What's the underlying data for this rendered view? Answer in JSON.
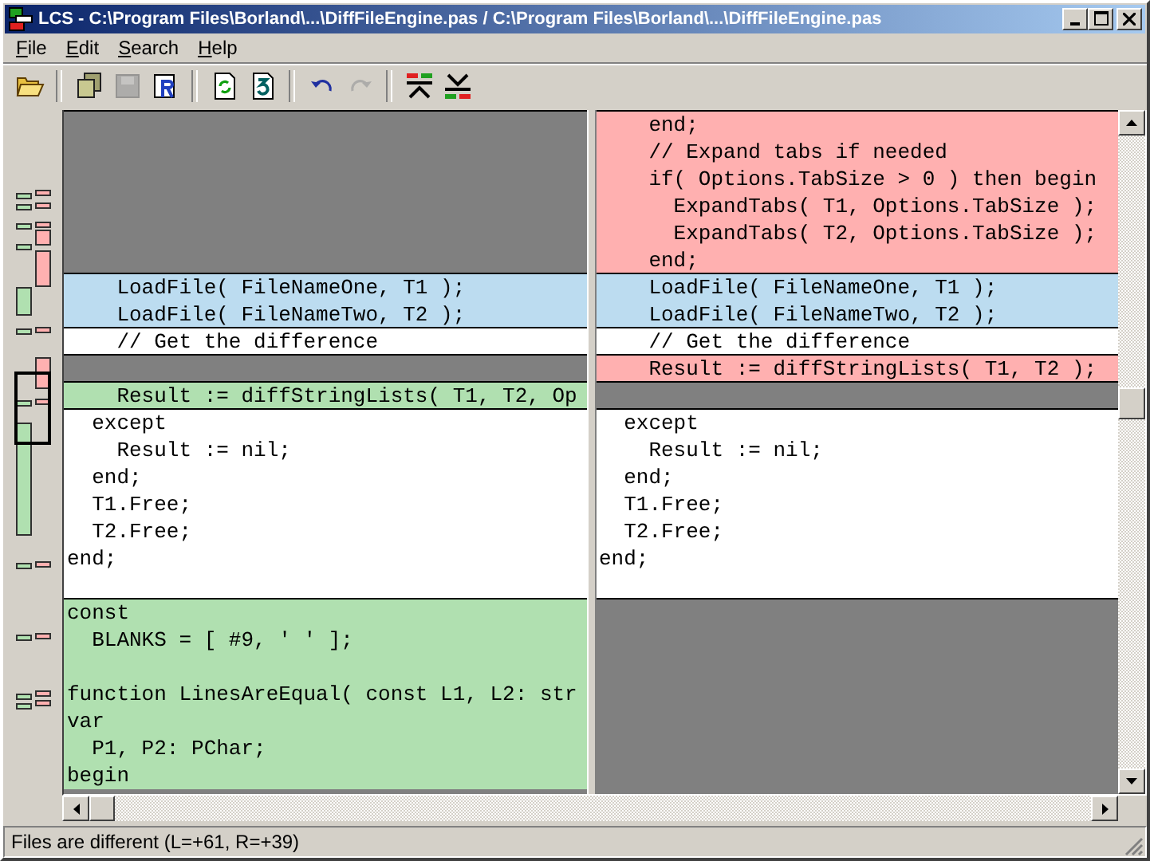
{
  "window": {
    "title": "LCS - C:\\Program Files\\Borland\\...\\DiffFileEngine.pas / C:\\Program Files\\Borland\\...\\DiffFileEngine.pas"
  },
  "menu": [
    "File",
    "Edit",
    "Search",
    "Help"
  ],
  "toolbar": [
    {
      "kind": "open",
      "disabled": false
    },
    {
      "kind": "separator"
    },
    {
      "kind": "copy",
      "disabled": false
    },
    {
      "kind": "save",
      "disabled": true
    },
    {
      "kind": "reload",
      "disabled": false
    },
    {
      "kind": "separator"
    },
    {
      "kind": "refresh",
      "disabled": false
    },
    {
      "kind": "page3",
      "disabled": false
    },
    {
      "kind": "separator"
    },
    {
      "kind": "undo",
      "disabled": false
    },
    {
      "kind": "redo",
      "disabled": true
    },
    {
      "kind": "separator"
    },
    {
      "kind": "prev-diff",
      "disabled": false
    },
    {
      "kind": "next-diff",
      "disabled": false
    }
  ],
  "left_pane": {
    "lines": [
      {
        "kind": "missing"
      },
      {
        "kind": "missing"
      },
      {
        "kind": "missing"
      },
      {
        "kind": "missing"
      },
      {
        "kind": "missing"
      },
      {
        "kind": "missing"
      },
      {
        "kind": "moved",
        "text": "    LoadFile( FileNameOne, T1 );"
      },
      {
        "kind": "moved",
        "text": "    LoadFile( FileNameTwo, T2 );"
      },
      {
        "kind": "same",
        "text": "    // Get the difference"
      },
      {
        "kind": "missing"
      },
      {
        "kind": "added",
        "text": "    Result := diffStringLists( T1, T2, Op"
      },
      {
        "kind": "same",
        "text": "  except"
      },
      {
        "kind": "same",
        "text": "    Result := nil;"
      },
      {
        "kind": "same",
        "text": "  end;"
      },
      {
        "kind": "same",
        "text": "  T1.Free;"
      },
      {
        "kind": "same",
        "text": "  T2.Free;"
      },
      {
        "kind": "same",
        "text": "end;"
      },
      {
        "kind": "same"
      },
      {
        "kind": "added",
        "text": "const"
      },
      {
        "kind": "added",
        "text": "  BLANKS = [ #9, ' ' ];"
      },
      {
        "kind": "added"
      },
      {
        "kind": "added",
        "text": "function LinesAreEqual( const L1, L2: str"
      },
      {
        "kind": "added",
        "text": "var"
      },
      {
        "kind": "added",
        "text": "  P1, P2: PChar;"
      },
      {
        "kind": "added",
        "text": "begin"
      }
    ]
  },
  "right_pane": {
    "lines": [
      {
        "kind": "deleted",
        "text": "    end;"
      },
      {
        "kind": "deleted",
        "text": "    // Expand tabs if needed"
      },
      {
        "kind": "deleted",
        "text": "    if( Options.TabSize > 0 ) then begin"
      },
      {
        "kind": "deleted",
        "text": "      ExpandTabs( T1, Options.TabSize );"
      },
      {
        "kind": "deleted",
        "text": "      ExpandTabs( T2, Options.TabSize );"
      },
      {
        "kind": "deleted",
        "text": "    end;"
      },
      {
        "kind": "moved",
        "text": "    LoadFile( FileNameOne, T1 );"
      },
      {
        "kind": "moved",
        "text": "    LoadFile( FileNameTwo, T2 );"
      },
      {
        "kind": "same",
        "text": "    // Get the difference"
      },
      {
        "kind": "deleted",
        "text": "    Result := diffStringLists( T1, T2 );"
      },
      {
        "kind": "missing"
      },
      {
        "kind": "same",
        "text": "  except"
      },
      {
        "kind": "same",
        "text": "    Result := nil;"
      },
      {
        "kind": "same",
        "text": "  end;"
      },
      {
        "kind": "same",
        "text": "  T1.Free;"
      },
      {
        "kind": "same",
        "text": "  T2.Free;"
      },
      {
        "kind": "same",
        "text": "end;"
      },
      {
        "kind": "same"
      },
      {
        "kind": "missing"
      },
      {
        "kind": "missing"
      },
      {
        "kind": "missing"
      },
      {
        "kind": "missing"
      },
      {
        "kind": "missing"
      },
      {
        "kind": "missing"
      },
      {
        "kind": "missing"
      }
    ]
  },
  "status_bar": "Files are different (L=+61, R=+39)"
}
